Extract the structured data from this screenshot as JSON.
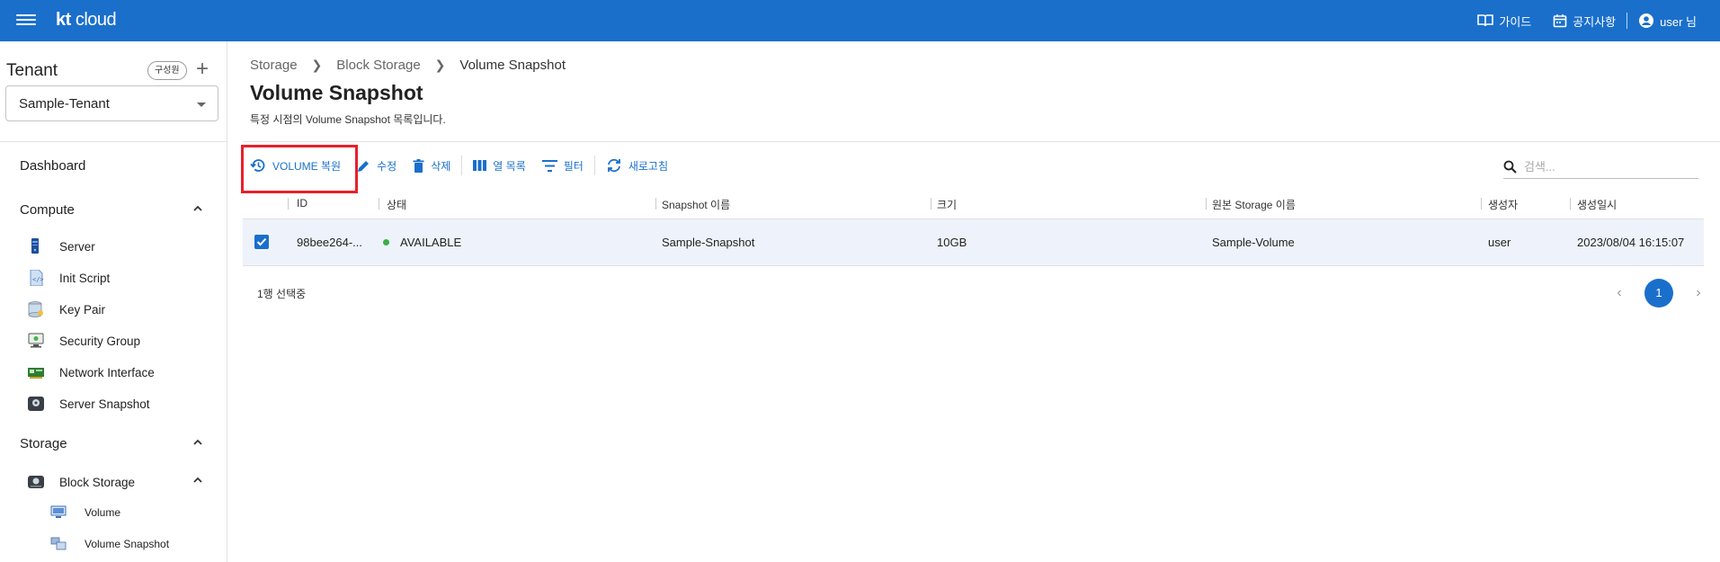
{
  "topbar": {
    "logo_kt": "kt",
    "logo_cloud": "cloud",
    "guide_label": "가이드",
    "notice_label": "공지사항",
    "user_label": "user 님"
  },
  "sidebar": {
    "tenant_title": "Tenant",
    "member_badge": "구성원",
    "plus": "+",
    "tenant_selected": "Sample-Tenant",
    "dashboard": "Dashboard",
    "compute_title": "Compute",
    "compute_items": [
      {
        "label": "Server",
        "icon": "server-icon"
      },
      {
        "label": "Init Script",
        "icon": "init-script-icon"
      },
      {
        "label": "Key Pair",
        "icon": "key-pair-icon"
      },
      {
        "label": "Security Group",
        "icon": "security-group-icon"
      },
      {
        "label": "Network Interface",
        "icon": "network-interface-icon"
      },
      {
        "label": "Server Snapshot",
        "icon": "server-snapshot-icon"
      }
    ],
    "storage_title": "Storage",
    "block_storage": "Block Storage",
    "storage_sub_items": [
      {
        "label": "Volume",
        "icon": "volume-icon"
      },
      {
        "label": "Volume Snapshot",
        "icon": "volume-snapshot-icon"
      }
    ]
  },
  "breadcrumb": [
    "Storage",
    "Block Storage",
    "Volume Snapshot"
  ],
  "page": {
    "title": "Volume Snapshot",
    "description": "특정 시점의 Volume Snapshot 목록입니다."
  },
  "toolbar": {
    "restore_label": "VOLUME 복원",
    "edit_label": "수정",
    "delete_label": "삭제",
    "columns_label": "열 목록",
    "filter_label": "필터",
    "refresh_label": "새로고침"
  },
  "search": {
    "placeholder": "검색..."
  },
  "table": {
    "columns": [
      "ID",
      "상태",
      "Snapshot 이름",
      "크기",
      "원본 Storage 이름",
      "생성자",
      "생성일시"
    ],
    "rows": [
      {
        "id": "98bee264-...",
        "status": "AVAILABLE",
        "snapshot_name": "Sample-Snapshot",
        "size": "10GB",
        "source_storage": "Sample-Volume",
        "creator": "user",
        "created_at": "2023/08/04 16:15:07",
        "checked": true
      }
    ]
  },
  "footer": {
    "selection_text": "1행 선택중",
    "current_page": "1",
    "prev": "‹",
    "next": "›"
  },
  "colors": {
    "brand": "#1a6fcb",
    "highlight": "#e8202a",
    "status_available": "#3cae4a"
  }
}
